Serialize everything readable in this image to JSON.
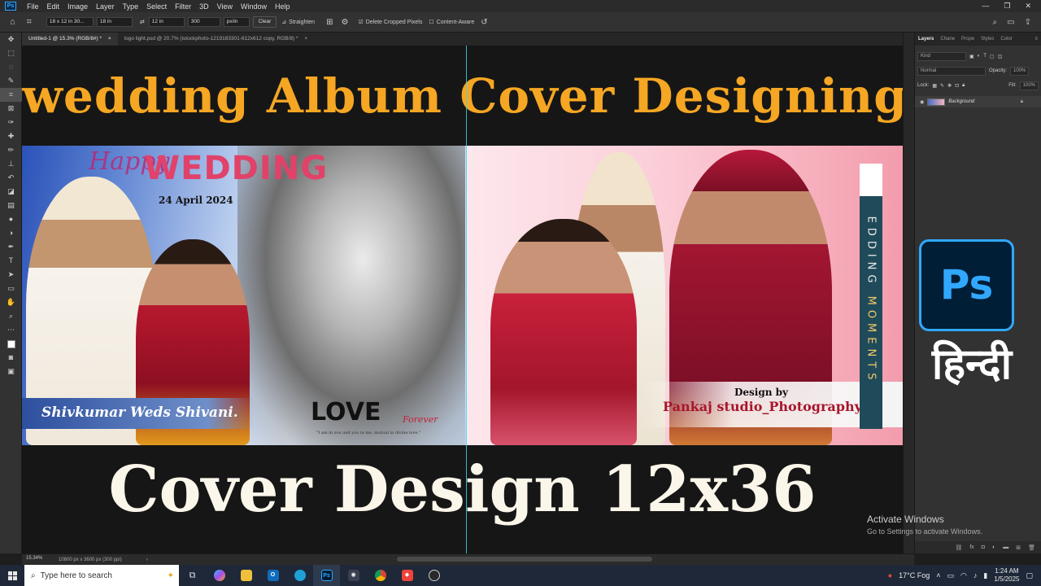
{
  "app": {
    "logo": "Ps",
    "menu": [
      "File",
      "Edit",
      "Image",
      "Layer",
      "Type",
      "Select",
      "Filter",
      "3D",
      "View",
      "Window",
      "Help"
    ]
  },
  "options_bar": {
    "ratio_preset": "18 x 12 in 30...",
    "width": "18 in",
    "height": "12 in",
    "resolution": "300",
    "resolution_unit": "px/in",
    "clear": "Clear",
    "straighten": "Straighten",
    "delete_cropped": "Delete Cropped Pixels",
    "content_aware": "Content-Aware"
  },
  "doc_tabs": [
    {
      "label": "Untitled-1 @ 15.3% (RGB/8#) *"
    },
    {
      "label": "logo light.psd @ 20.7% (istockphoto-1219183301-612x612 copy, RGB/8) *"
    }
  ],
  "canvas": {
    "headline": "wedding Album Cover Designing",
    "cover_left": {
      "title": "WEDDING",
      "script": "Happy",
      "date": "24 April 2024",
      "names": "Shivkumar Weds Shivani.",
      "love": "LOVE",
      "forever": "Forever",
      "quote": "\"I am in you and you in me, mutual in divine love.\""
    },
    "cover_right": {
      "design_by": "Design by",
      "studio": "Pankaj studio_Photography",
      "vertical_a": "EDDING",
      "vertical_b": "MOMENTS"
    },
    "bottom_line": "Cover Design 12x36"
  },
  "layers_panel": {
    "tabs": [
      "Layers",
      "Chane",
      "Prope",
      "Styles",
      "Color"
    ],
    "kind": "Kind",
    "blend": "Normal",
    "opacity_label": "Opacity:",
    "opacity": "100%",
    "lock_label": "Lock:",
    "fill_label": "Fill:",
    "fill": "100%",
    "layer_name": "Background"
  },
  "overlay": {
    "ps_badge": "Ps",
    "hindi": "हिन्दी",
    "activate_title": "Activate Windows",
    "activate_sub": "Go to Settings to activate Windows."
  },
  "status": {
    "zoom": "15.34%",
    "doc_size": "10800 px x 3600 px (300 ppi)"
  },
  "taskbar": {
    "search": "Type here to search",
    "weather": "17°C  Fog",
    "time": "1:24 AM",
    "date": "1/5/2025"
  }
}
